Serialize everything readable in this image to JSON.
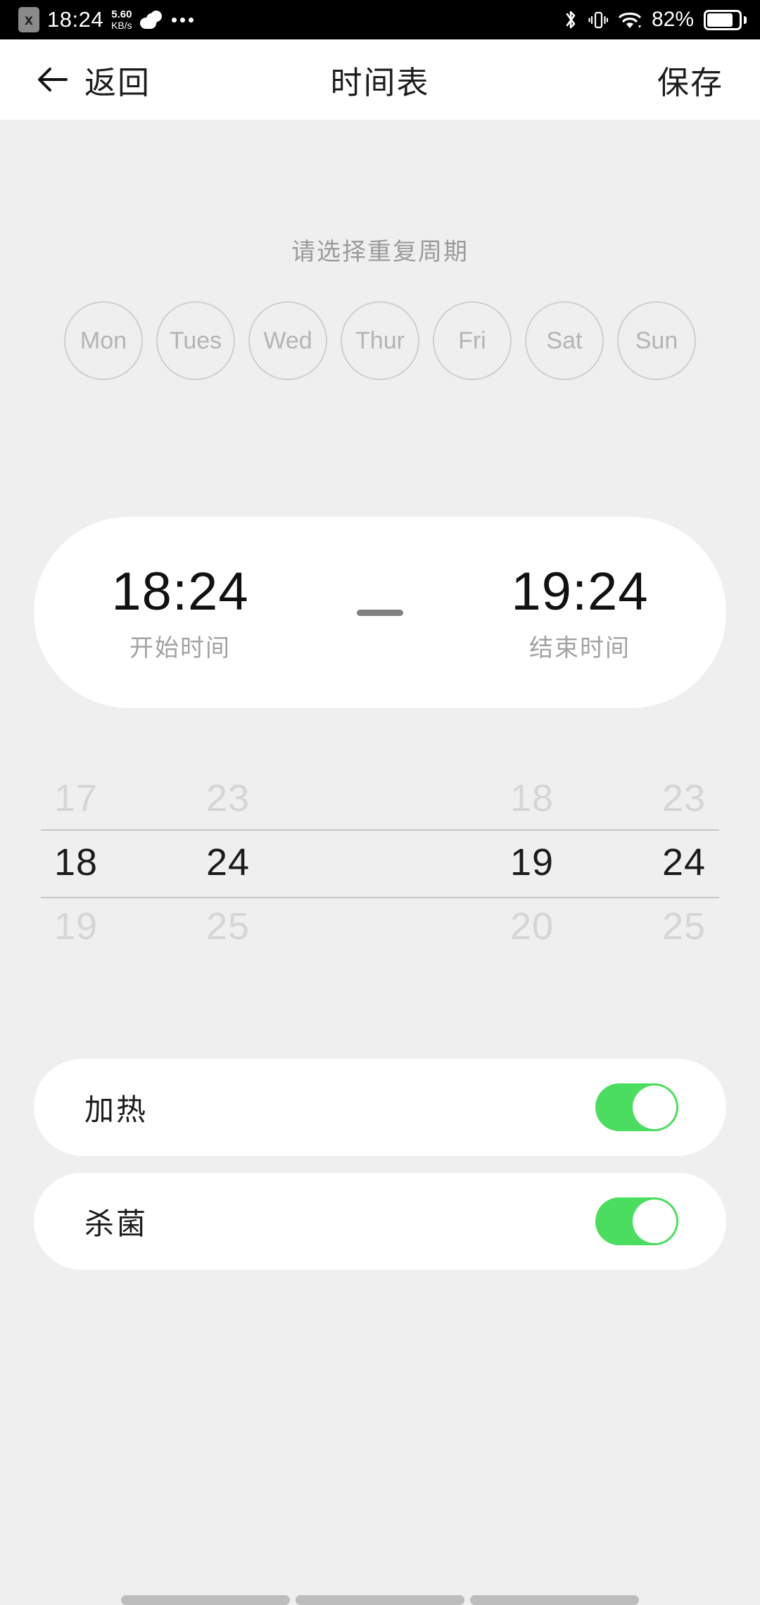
{
  "status_bar": {
    "sim_badge": "x",
    "clock": "18:24",
    "net_speed_value": "5.60",
    "net_speed_unit": "KB/s",
    "weather_icon": "cloud-icon",
    "overflow_icon": "more-dots-icon",
    "bluetooth_icon": "bluetooth-icon",
    "vibrate_icon": "vibrate-icon",
    "wifi_icon": "wifi-icon",
    "battery_percent": "82%",
    "battery_icon": "battery-icon"
  },
  "app_bar": {
    "back_icon": "arrow-left-icon",
    "back_label": "返回",
    "title": "时间表",
    "save_label": "保存"
  },
  "repeat": {
    "hint": "请选择重复周期",
    "days": [
      {
        "label": "Mon",
        "selected": false
      },
      {
        "label": "Tues",
        "selected": false
      },
      {
        "label": "Wed",
        "selected": false
      },
      {
        "label": "Thur",
        "selected": false
      },
      {
        "label": "Fri",
        "selected": false
      },
      {
        "label": "Sat",
        "selected": false
      },
      {
        "label": "Sun",
        "selected": false
      }
    ]
  },
  "time_card": {
    "start_time": "18:24",
    "start_label": "开始时间",
    "separator": "—",
    "end_time": "19:24",
    "end_label": "结束时间"
  },
  "picker": {
    "columns": [
      {
        "name": "start-hour",
        "prev": "17",
        "current": "18",
        "next": "19"
      },
      {
        "name": "start-minute",
        "prev": "23",
        "current": "24",
        "next": "25"
      },
      {
        "name": "end-hour",
        "prev": "18",
        "current": "19",
        "next": "20"
      },
      {
        "name": "end-minute",
        "prev": "23",
        "current": "24",
        "next": "25"
      }
    ]
  },
  "options": [
    {
      "label": "加热",
      "enabled": true
    },
    {
      "label": "杀菌",
      "enabled": true
    }
  ],
  "colors": {
    "accent_green": "#4bdd5f",
    "page_background": "#efefef",
    "card_background": "#ffffff",
    "muted_text": "#a2a2a2"
  },
  "nav_bar": {
    "pills": [
      "recents-pill",
      "home-pill",
      "back-pill"
    ]
  }
}
